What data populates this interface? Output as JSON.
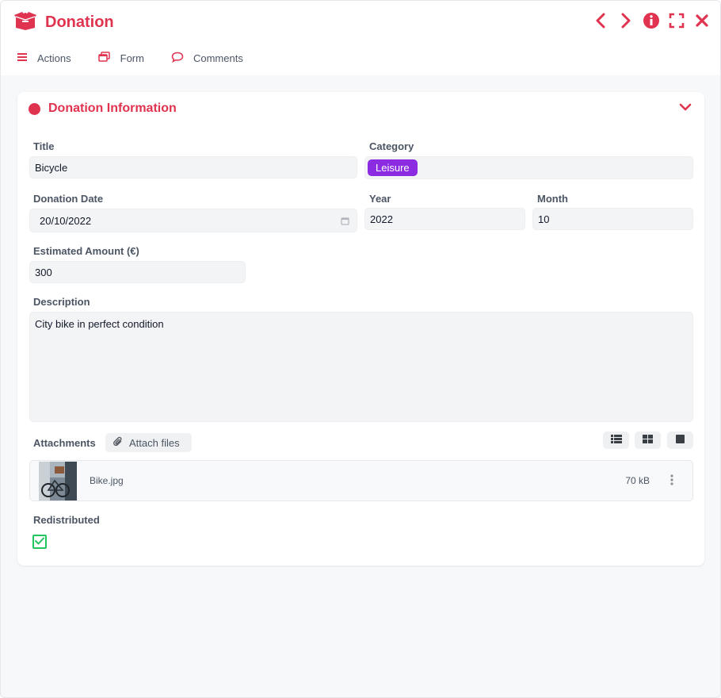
{
  "window": {
    "title": "Donation",
    "accent_color": "#e0334f",
    "header_icons": [
      "chevron-left-icon",
      "chevron-right-icon",
      "info-icon",
      "fullscreen-icon",
      "close-icon"
    ]
  },
  "toolbar": {
    "items": [
      {
        "label": "Actions",
        "icon": "hamburger-icon"
      },
      {
        "label": "Form",
        "icon": "window-stack-icon"
      },
      {
        "label": "Comments",
        "icon": "comment-bubble-icon"
      }
    ]
  },
  "section": {
    "title": "Donation Information",
    "collapsed": false
  },
  "fields": {
    "title": {
      "label": "Title",
      "value": "Bicycle"
    },
    "category": {
      "label": "Category",
      "value": "Leisure",
      "tag_color": "#8b2be2"
    },
    "donation_date": {
      "label": "Donation Date",
      "value": "20/10/2022"
    },
    "year": {
      "label": "Year",
      "value": "2022"
    },
    "month": {
      "label": "Month",
      "value": "10"
    },
    "estimated_amount": {
      "label": "Estimated Amount (€)",
      "value": "300"
    },
    "description": {
      "label": "Description",
      "value": "City bike in perfect condition"
    }
  },
  "attachments": {
    "label": "Attachments",
    "attach_button": "Attach files",
    "view_modes": [
      "list-view-icon",
      "grid-view-icon",
      "single-view-icon"
    ],
    "files": [
      {
        "name": "Bike.jpg",
        "size": "70 kB"
      }
    ]
  },
  "redistributed": {
    "label": "Redistributed",
    "checked": true,
    "check_color": "#22c55e"
  }
}
